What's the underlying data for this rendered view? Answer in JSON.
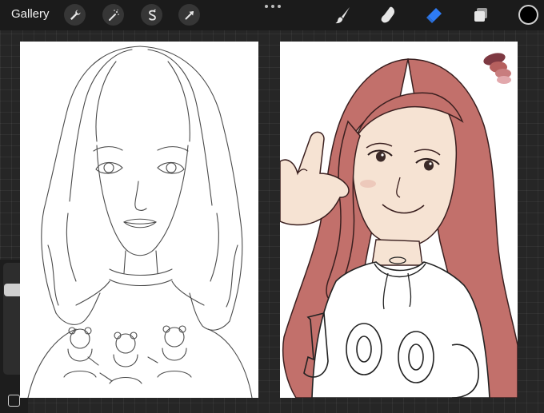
{
  "toolbar": {
    "gallery_label": "Gallery",
    "left_tools": [
      {
        "name": "actions",
        "icon": "wrench-icon"
      },
      {
        "name": "adjustments",
        "icon": "magic-wand-icon"
      },
      {
        "name": "selection",
        "icon": "selection-s-icon"
      },
      {
        "name": "transform",
        "icon": "arrow-cursor-icon"
      }
    ],
    "right_tools": [
      {
        "name": "brush",
        "icon": "brush-icon",
        "active": false
      },
      {
        "name": "smudge",
        "icon": "smudge-finger-icon",
        "active": false
      },
      {
        "name": "eraser",
        "icon": "eraser-icon",
        "active": true
      },
      {
        "name": "layers",
        "icon": "layers-icon",
        "active": false
      }
    ],
    "current_color": "#000000"
  },
  "colors": {
    "accent": "#2e7cf6",
    "hair": "#c2706b",
    "skin": "#f6e3d3",
    "background": "#262626"
  },
  "sidebar": {
    "brush_size_level": 0.2
  },
  "palette_swatches": [
    "#7e3942",
    "#b6605e",
    "#c87d7e",
    "#e2a8ac"
  ]
}
